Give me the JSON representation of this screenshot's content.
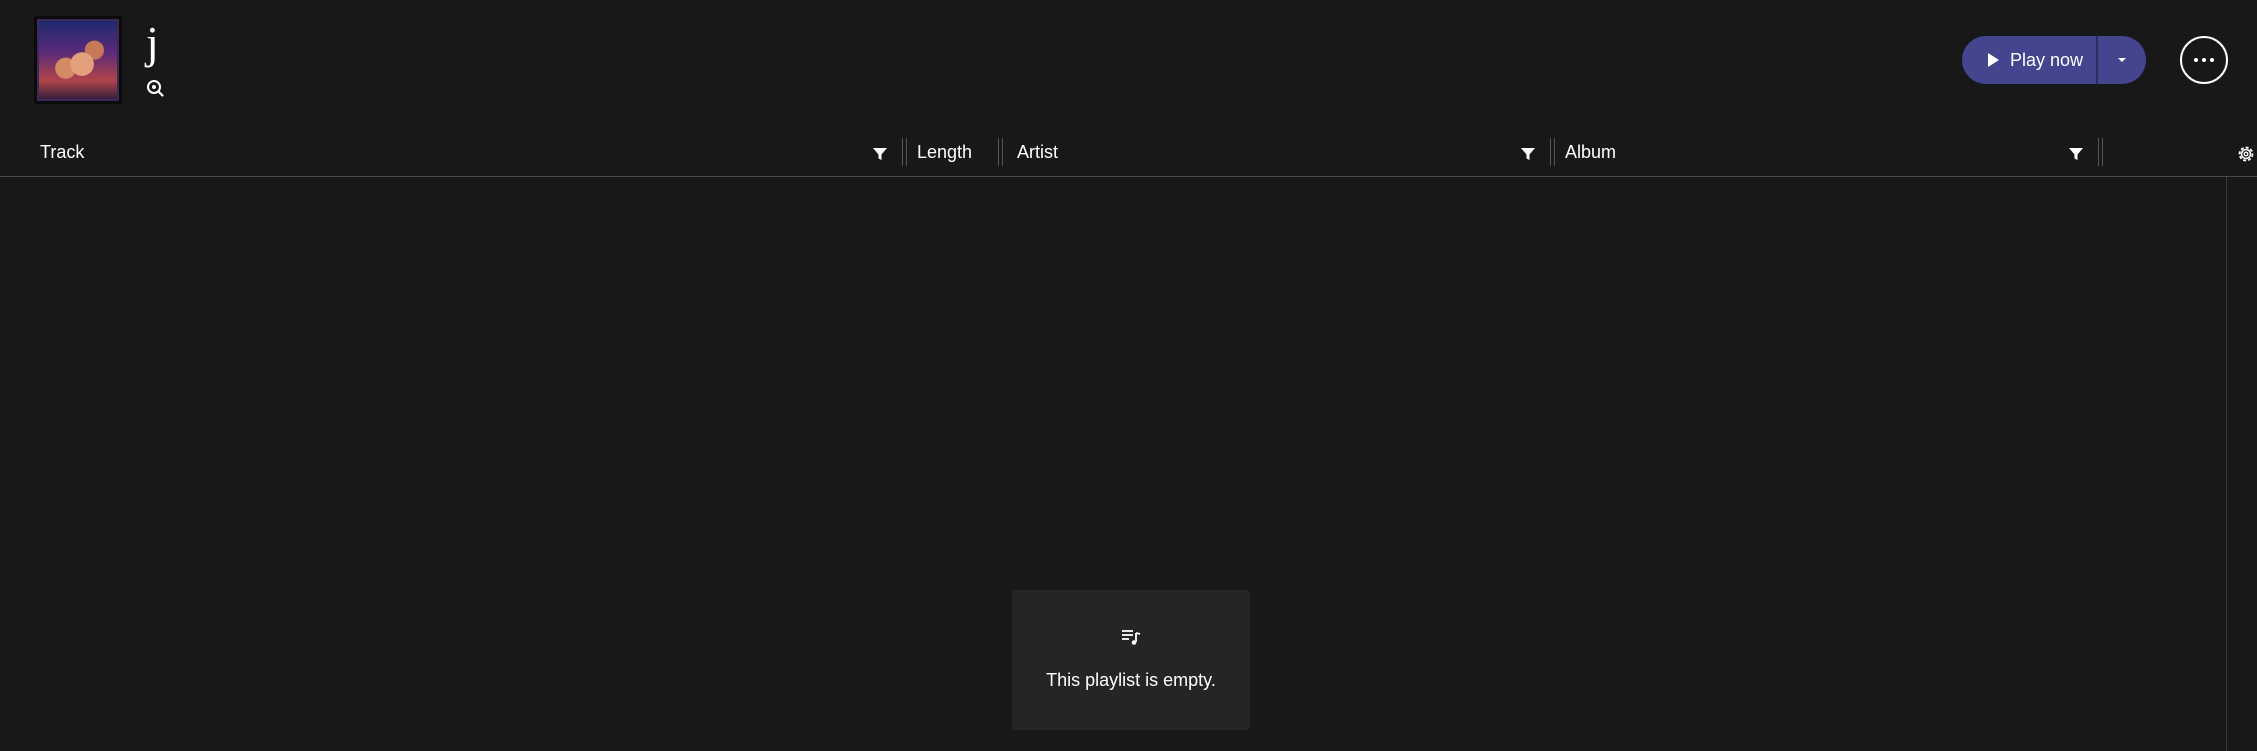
{
  "playlist": {
    "title": "j",
    "cover_icon": "album-art",
    "title_icon": "search-icon"
  },
  "actions": {
    "play_label": "Play now",
    "play_icon": "play-icon",
    "dropdown_icon": "caret-down-icon",
    "more_icon": "more-horizontal-icon"
  },
  "columns": [
    {
      "label": "Track",
      "filter": true
    },
    {
      "label": "Length",
      "filter": false
    },
    {
      "label": "Artist",
      "filter": true
    },
    {
      "label": "Album",
      "filter": true
    }
  ],
  "settings_icon": "gear-icon",
  "empty_state": {
    "icon": "playlist-music-icon",
    "message": "This playlist is empty."
  },
  "colors": {
    "background": "#181818",
    "accent": "#43458f",
    "panel": "#252525"
  }
}
